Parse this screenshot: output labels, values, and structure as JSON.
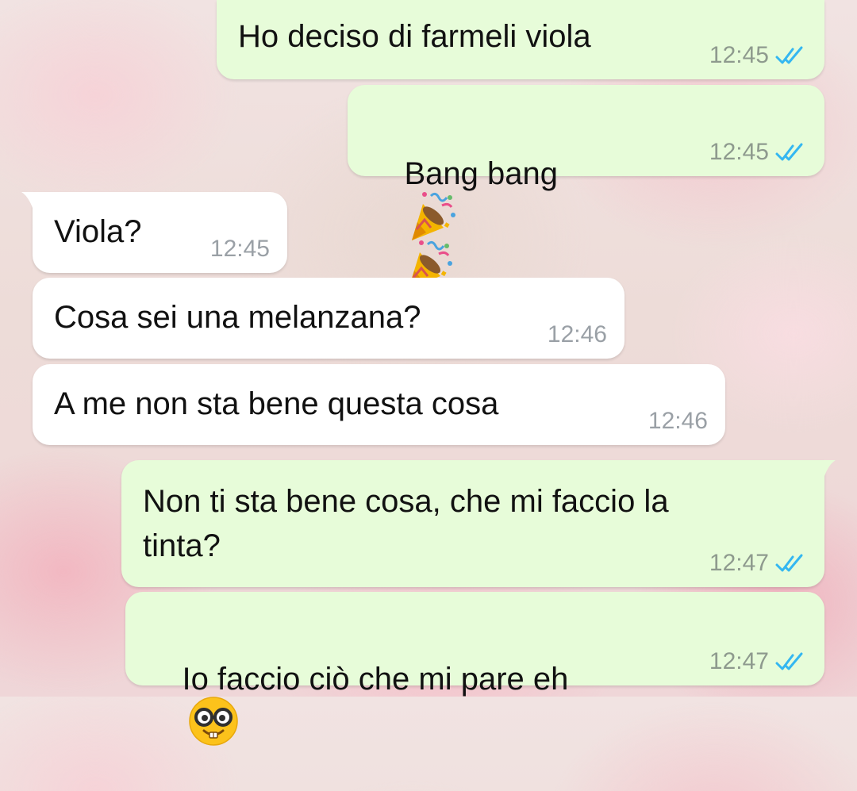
{
  "messages": [
    {
      "dir": "out",
      "text": "Ho deciso di farmeli viola",
      "time": "12:45",
      "status": "read"
    },
    {
      "dir": "out",
      "text": "Bang bang",
      "emoji": [
        "party-popper",
        "party-popper"
      ],
      "time": "12:45",
      "status": "read"
    },
    {
      "dir": "in",
      "text": "Viola?",
      "time": "12:45"
    },
    {
      "dir": "in",
      "text": "Cosa sei una melanzana?",
      "time": "12:46"
    },
    {
      "dir": "in",
      "text": "A me non sta bene questa cosa",
      "time": "12:46"
    },
    {
      "dir": "out",
      "text": "Non ti sta bene cosa, che mi faccio la\ntinta?",
      "time": "12:47",
      "status": "read"
    },
    {
      "dir": "out",
      "text": "Io faccio ciò che mi pare eh",
      "emoji": [
        "nerd-face"
      ],
      "time": "12:47",
      "status": "read"
    }
  ],
  "colors": {
    "outgoing_bubble": "#e7fcd9",
    "incoming_bubble": "#ffffff",
    "read_ticks": "#34b7f1",
    "timestamp": "#8e9a8e"
  }
}
